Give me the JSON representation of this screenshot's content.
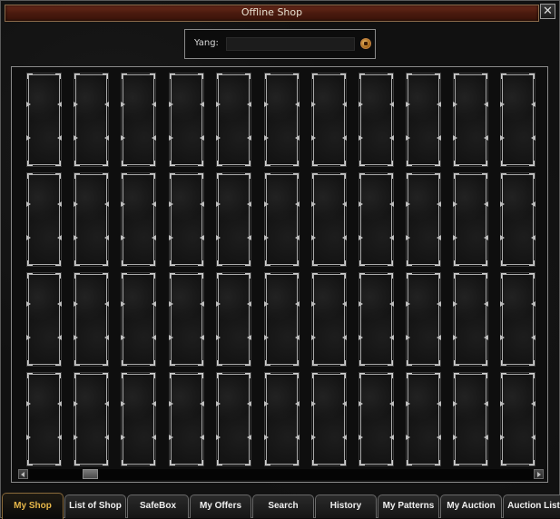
{
  "window": {
    "title": "Offline Shop",
    "close_label": "✕"
  },
  "yang": {
    "label": "Yang:",
    "value": ""
  },
  "grid": {
    "rows": 4,
    "cols": 11
  },
  "tabs": [
    {
      "label": "My Shop",
      "active": true
    },
    {
      "label": "List of Shop",
      "active": false
    },
    {
      "label": "SafeBox",
      "active": false
    },
    {
      "label": "My Offers",
      "active": false
    },
    {
      "label": "Search",
      "active": false
    },
    {
      "label": "History",
      "active": false
    },
    {
      "label": "My Patterns",
      "active": false
    },
    {
      "label": "My Auction",
      "active": false
    },
    {
      "label": "Auction List",
      "active": false
    }
  ],
  "colors": {
    "active_tab_text": "#e8b84a",
    "title_bar": "#5a1e10"
  }
}
